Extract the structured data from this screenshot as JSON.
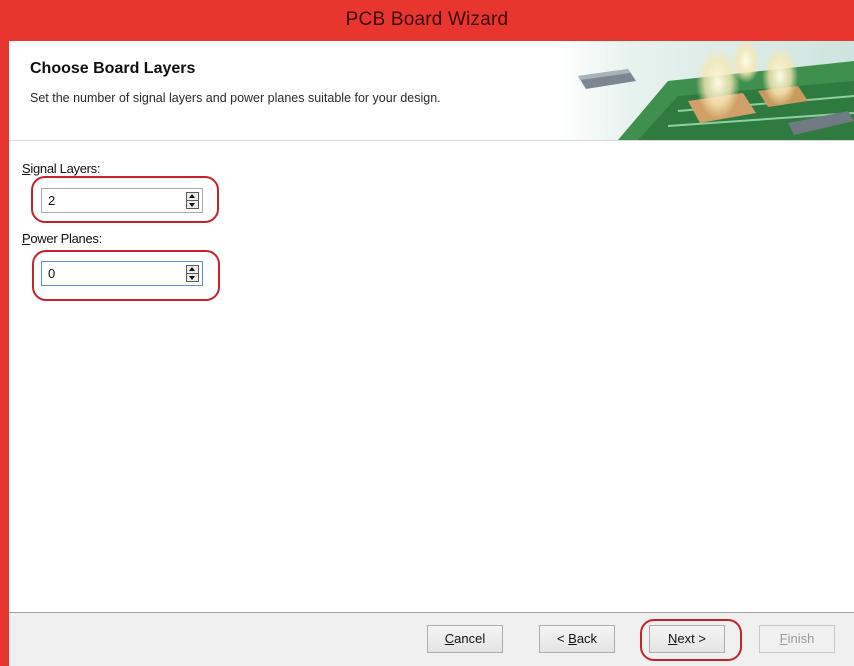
{
  "window": {
    "title": "PCB Board Wizard",
    "accent_color": "#e8362f"
  },
  "header": {
    "title": "Choose Board Layers",
    "subtitle": "Set the number of signal layers and power planes suitable for your design.",
    "image": "pcb-chip-illustration"
  },
  "fields": {
    "signal_layers": {
      "label_mnemonic": "S",
      "label_rest": "ignal Layers:",
      "value": "2"
    },
    "power_planes": {
      "label_mnemonic": "P",
      "label_rest": "ower Planes:",
      "value": "0"
    }
  },
  "buttons": {
    "cancel": {
      "mnemonic": "C",
      "rest": "ancel"
    },
    "back": {
      "prefix": "< ",
      "mnemonic": "B",
      "rest": "ack"
    },
    "next": {
      "mnemonic": "N",
      "rest": "ext >"
    },
    "finish": {
      "mnemonic": "F",
      "rest": "inish",
      "enabled": false
    }
  },
  "annotation_color": "#c3232b"
}
